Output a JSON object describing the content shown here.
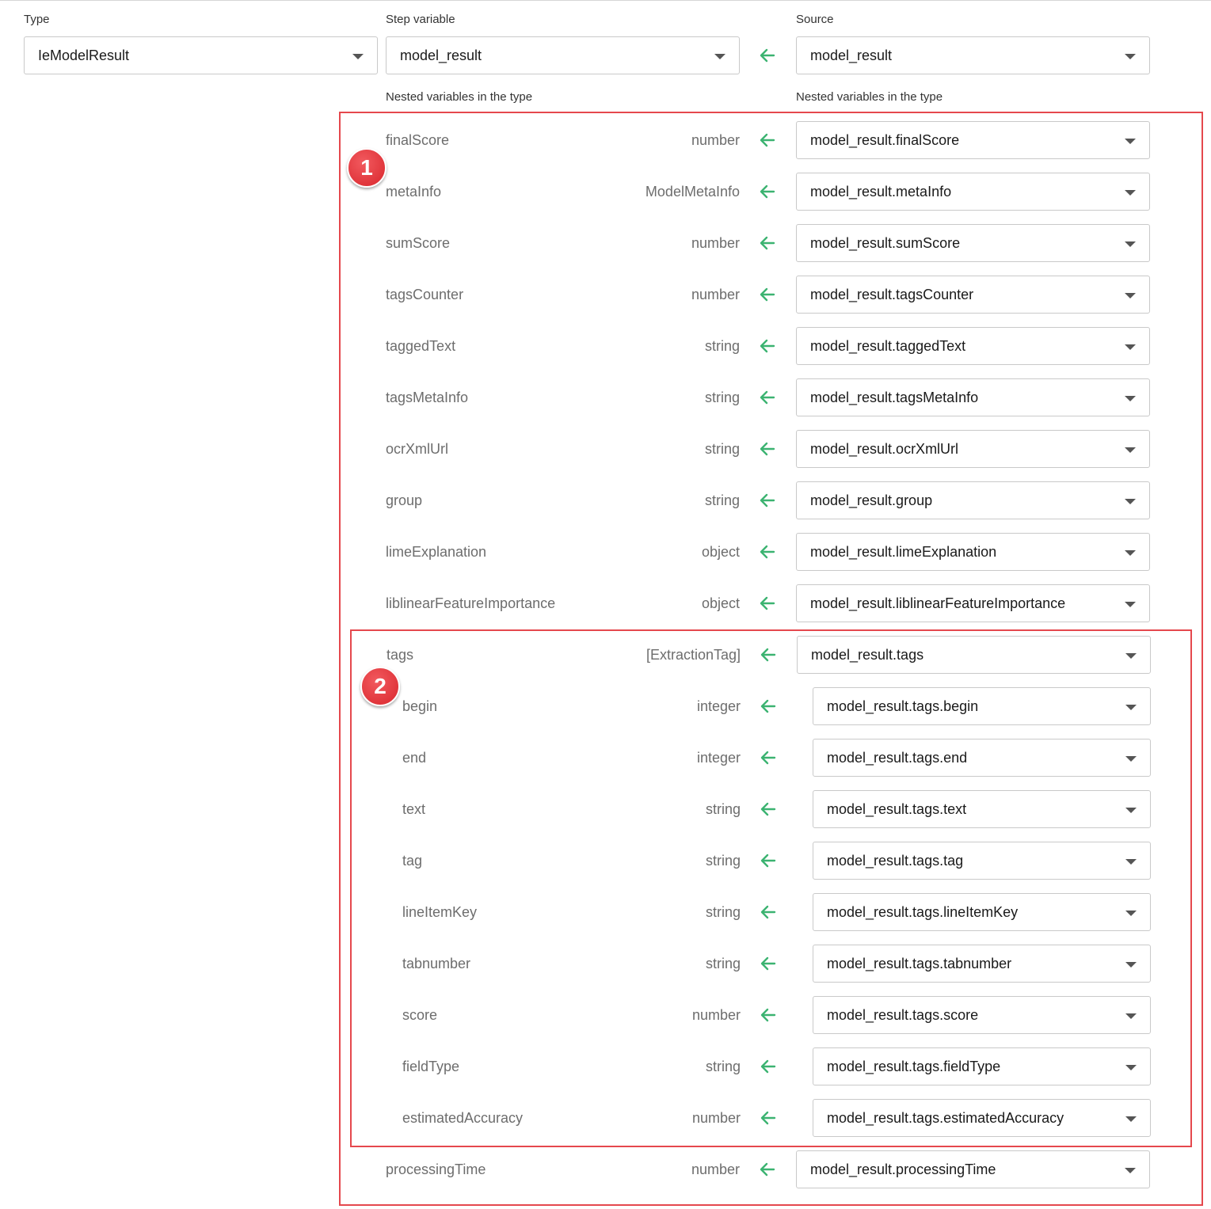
{
  "headers": {
    "type": "Type",
    "step_variable": "Step variable",
    "source": "Source",
    "nested_left": "Nested variables in the type",
    "nested_right": "Nested variables in the type"
  },
  "top": {
    "type_value": "IeModelResult",
    "step_variable_value": "model_result",
    "source_value": "model_result"
  },
  "badges": [
    "1",
    "2"
  ],
  "colors": {
    "arrow": "#3cb371",
    "highlight": "#e5484d"
  },
  "rows": [
    {
      "name": "finalScore",
      "type": "number",
      "source": "model_result.finalScore"
    },
    {
      "name": "metaInfo",
      "type": "ModelMetaInfo",
      "source": "model_result.metaInfo"
    },
    {
      "name": "sumScore",
      "type": "number",
      "source": "model_result.sumScore"
    },
    {
      "name": "tagsCounter",
      "type": "number",
      "source": "model_result.tagsCounter"
    },
    {
      "name": "taggedText",
      "type": "string",
      "source": "model_result.taggedText"
    },
    {
      "name": "tagsMetaInfo",
      "type": "string",
      "source": "model_result.tagsMetaInfo"
    },
    {
      "name": "ocrXmlUrl",
      "type": "string",
      "source": "model_result.ocrXmlUrl"
    },
    {
      "name": "group",
      "type": "string",
      "source": "model_result.group"
    },
    {
      "name": "limeExplanation",
      "type": "object",
      "source": "model_result.limeExplanation"
    },
    {
      "name": "liblinearFeatureImportance",
      "type": "object",
      "source": "model_result.liblinearFeatureImportance"
    },
    {
      "name": "tags",
      "type": "[ExtractionTag]",
      "source": "model_result.tags"
    },
    {
      "name": "begin",
      "type": "integer",
      "source": "model_result.tags.begin",
      "nested": true
    },
    {
      "name": "end",
      "type": "integer",
      "source": "model_result.tags.end",
      "nested": true
    },
    {
      "name": "text",
      "type": "string",
      "source": "model_result.tags.text",
      "nested": true
    },
    {
      "name": "tag",
      "type": "string",
      "source": "model_result.tags.tag",
      "nested": true
    },
    {
      "name": "lineItemKey",
      "type": "string",
      "source": "model_result.tags.lineItemKey",
      "nested": true
    },
    {
      "name": "tabnumber",
      "type": "string",
      "source": "model_result.tags.tabnumber",
      "nested": true
    },
    {
      "name": "score",
      "type": "number",
      "source": "model_result.tags.score",
      "nested": true
    },
    {
      "name": "fieldType",
      "type": "string",
      "source": "model_result.tags.fieldType",
      "nested": true
    },
    {
      "name": "estimatedAccuracy",
      "type": "number",
      "source": "model_result.tags.estimatedAccuracy",
      "nested": true
    },
    {
      "name": "processingTime",
      "type": "number",
      "source": "model_result.processingTime"
    }
  ]
}
